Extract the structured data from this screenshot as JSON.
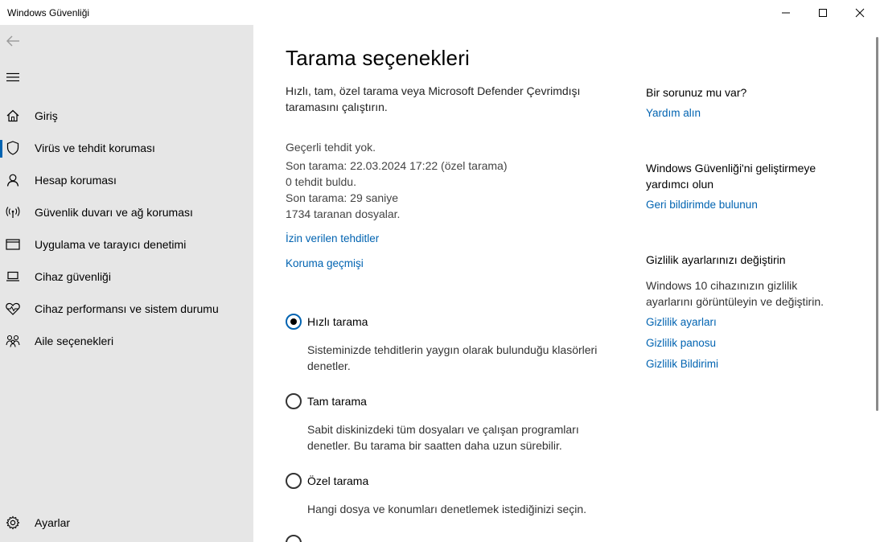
{
  "window": {
    "title": "Windows Güvenliği"
  },
  "sidebar": {
    "items": [
      {
        "label": "Giriş",
        "icon": "home-icon"
      },
      {
        "label": "Virüs ve tehdit koruması",
        "icon": "shield-icon"
      },
      {
        "label": "Hesap koruması",
        "icon": "person-icon"
      },
      {
        "label": "Güvenlik duvarı ve ağ koruması",
        "icon": "antenna-icon"
      },
      {
        "label": "Uygulama ve tarayıcı denetimi",
        "icon": "app-window-icon"
      },
      {
        "label": "Cihaz güvenliği",
        "icon": "laptop-icon"
      },
      {
        "label": "Cihaz performansı ve sistem durumu",
        "icon": "heart-icon"
      },
      {
        "label": "Aile seçenekleri",
        "icon": "family-icon"
      }
    ],
    "settings_label": "Ayarlar",
    "active_index": 1
  },
  "main": {
    "title": "Tarama seçenekleri",
    "description": "Hızlı, tam, özel tarama veya Microsoft Defender Çevrimdışı taramasını çalıştırın.",
    "status": {
      "no_threats": "Geçerli tehdit yok.",
      "last_scan": "Son tarama: 22.03.2024 17:22 (özel tarama)",
      "threats_found": "0 tehdit buldu.",
      "duration": "Son tarama: 29 saniye",
      "files_scanned": "1734 taranan dosyalar."
    },
    "links": {
      "allowed_threats": "İzin verilen tehditler",
      "protection_history": "Koruma geçmişi"
    },
    "scan_options": [
      {
        "label": "Hızlı tarama",
        "description": "Sisteminizde tehditlerin yaygın olarak bulunduğu klasörleri denetler.",
        "selected": true
      },
      {
        "label": "Tam tarama",
        "description": "Sabit diskinizdeki tüm dosyaları ve çalışan programları denetler. Bu tarama bir saatten daha uzun sürebilir.",
        "selected": false
      },
      {
        "label": "Özel tarama",
        "description": "Hangi dosya ve konumları denetlemek istediğinizi seçin.",
        "selected": false
      }
    ]
  },
  "right": {
    "help_title": "Bir sorunuz mu var?",
    "help_link": "Yardım alın",
    "improve_title": "Windows Güvenliği'ni geliştirmeye yardımcı olun",
    "improve_link": "Geri bildirimde bulunun",
    "privacy_title": "Gizlilik ayarlarınızı değiştirin",
    "privacy_text": "Windows 10 cihazınızın gizlilik ayarlarını görüntüleyin ve değiştirin.",
    "privacy_links": [
      "Gizlilik ayarları",
      "Gizlilik panosu",
      "Gizlilik Bildirimi"
    ]
  },
  "colors": {
    "accent": "#0063b1",
    "sidebar_bg": "#e6e6e6"
  }
}
